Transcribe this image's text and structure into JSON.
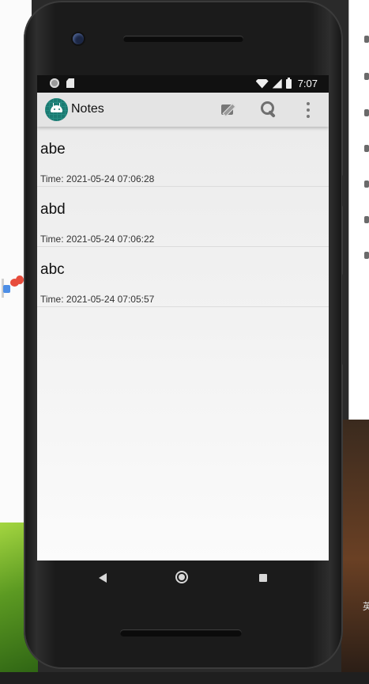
{
  "status_bar": {
    "time": "7:07"
  },
  "app_bar": {
    "title": "Notes"
  },
  "notes": [
    {
      "title": "abe",
      "time": "Time: 2021-05-24 07:06:28"
    },
    {
      "title": "abd",
      "time": "Time: 2021-05-24 07:06:22"
    },
    {
      "title": "abc",
      "time": "Time: 2021-05-24 07:05:57"
    }
  ],
  "desktop": {
    "side_text": "英"
  },
  "colors": {
    "app_bar_bg": "#e4e4e4",
    "list_bg": "#ececec",
    "logo_bg": "#1b7a72",
    "phone_body": "#1b1b1b"
  },
  "icons": {
    "status_left": [
      "notification-dot-icon",
      "sd-card-icon"
    ],
    "status_right": [
      "wifi-icon",
      "signal-icon",
      "battery-icon"
    ],
    "actions": [
      "edit-note-icon",
      "search-icon",
      "overflow-menu-icon"
    ],
    "nav": [
      "back-icon",
      "home-icon",
      "recents-icon"
    ]
  }
}
